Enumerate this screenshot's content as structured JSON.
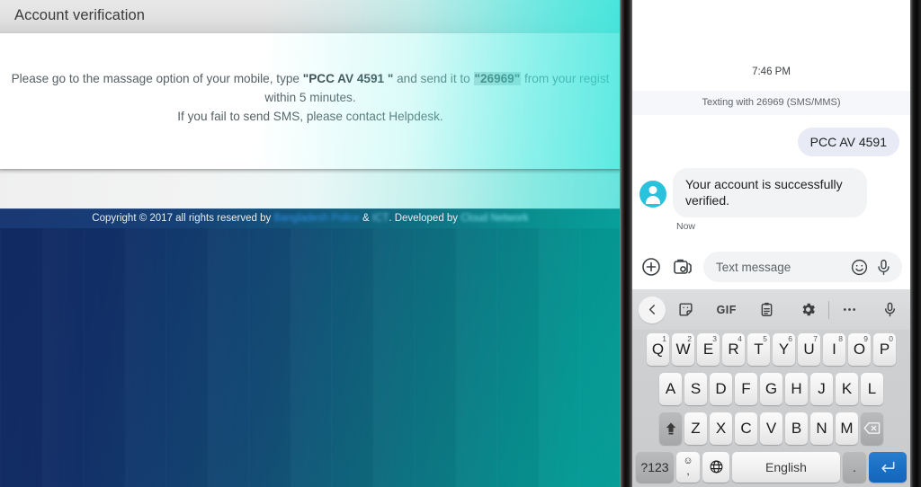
{
  "desktop": {
    "panel": {
      "title": "Account verification",
      "instruction_prefix": "Please go to the massage option of your mobile, type ",
      "code": "\"PCC AV 4591 \"",
      "instruction_mid": " and send it to ",
      "shortcode": "\"26969\"",
      "instruction_suffix": " from your regist",
      "line2": "within 5 minutes.",
      "line3": "If you fail to send SMS, please contact Helpdesk."
    },
    "footer": {
      "copyright": "Copyright © 2017 all rights reserved by",
      "link1": "Bangladesh Police",
      "amp": "&",
      "link2": "ICT",
      "developed_by": ". Developed by",
      "link3": "Cloud Network"
    }
  },
  "phone": {
    "conversation": {
      "time": "7:46 PM",
      "banner": "Texting with 26969 (SMS/MMS)",
      "outgoing_message": "PCC AV 4591",
      "incoming_message": "Your account is successfully verified.",
      "incoming_time": "Now"
    },
    "compose": {
      "placeholder": "Text message"
    },
    "keyboard": {
      "toolbar": [
        "back-chevron-icon",
        "sticker-icon",
        "gif-icon",
        "clipboard-icon",
        "gear-icon",
        "divider",
        "more-options-icon",
        "microphone-icon"
      ],
      "gif_label": "GIF",
      "row1": [
        {
          "letter": "Q",
          "num": "1"
        },
        {
          "letter": "W",
          "num": "2"
        },
        {
          "letter": "E",
          "num": "3"
        },
        {
          "letter": "R",
          "num": "4"
        },
        {
          "letter": "T",
          "num": "5"
        },
        {
          "letter": "Y",
          "num": "6"
        },
        {
          "letter": "U",
          "num": "7"
        },
        {
          "letter": "I",
          "num": "8"
        },
        {
          "letter": "O",
          "num": "9"
        },
        {
          "letter": "P",
          "num": "0"
        }
      ],
      "row2": [
        "A",
        "S",
        "D",
        "F",
        "G",
        "H",
        "J",
        "K",
        "L"
      ],
      "row3": [
        "Z",
        "X",
        "C",
        "V",
        "B",
        "N",
        "M"
      ],
      "symbols_key": "?123",
      "comma_key": ",",
      "space_key": "English",
      "period_key": ".",
      "shift_icon": "shift-up-arrow-icon",
      "backspace_icon": "backspace-icon",
      "globe_icon": "globe-icon",
      "enter_icon": "enter-return-icon"
    }
  },
  "colors": {
    "accent_teal": "#29c2dd",
    "enter_blue": "#1a6fc4",
    "bubble_out": "#e8eaf6",
    "bubble_in": "#f1f3f4",
    "desktop_dark_blue": "#11285f"
  }
}
